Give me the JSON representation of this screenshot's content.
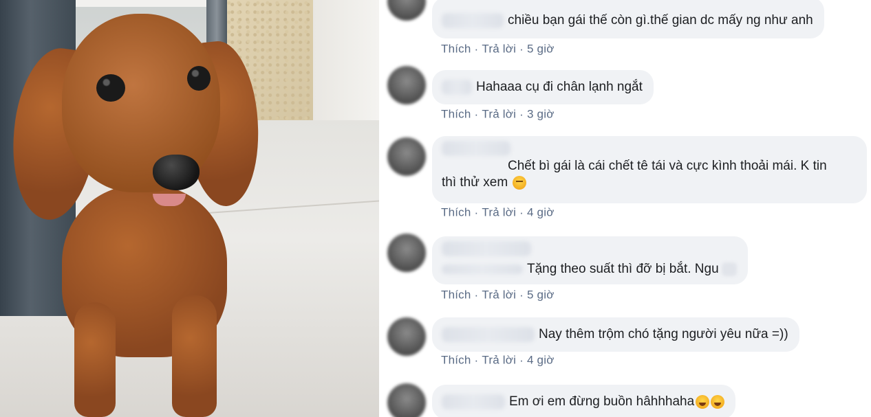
{
  "post_photo": {
    "alt_subject": "dog-photo"
  },
  "comments": [
    {
      "text": "chiều bạn gái thế còn gì.thế gian dc mấy ng như anh",
      "like": "Thích",
      "reply": "Trả lời",
      "sep": "·",
      "time": "5 giờ"
    },
    {
      "text": "Hahaaa cụ đi chân lạnh ngắt",
      "like": "Thích",
      "reply": "Trả lời",
      "sep": "·",
      "time": "3 giờ"
    },
    {
      "text_line1": "Chết bì gái là cái chết tê tái và cực kình thoải mái. K tin",
      "text_line2": "thì thử xem",
      "emoji": "relieved-face-emoji",
      "like": "Thích",
      "reply": "Trả lời",
      "sep": "·",
      "time": "4 giờ"
    },
    {
      "text": "Tặng theo suất thì đỡ bị bắt. Ngu",
      "like": "Thích",
      "reply": "Trả lời",
      "sep": "·",
      "time": "5 giờ"
    },
    {
      "text": "Nay thêm trộm chó tặng người yêu nữa =))",
      "like": "Thích",
      "reply": "Trả lời",
      "sep": "·",
      "time": "4 giờ"
    },
    {
      "text": "Em ơi em đừng buồn hâhhhaha",
      "emoji": "rolling-laughing-emoji"
    }
  ]
}
